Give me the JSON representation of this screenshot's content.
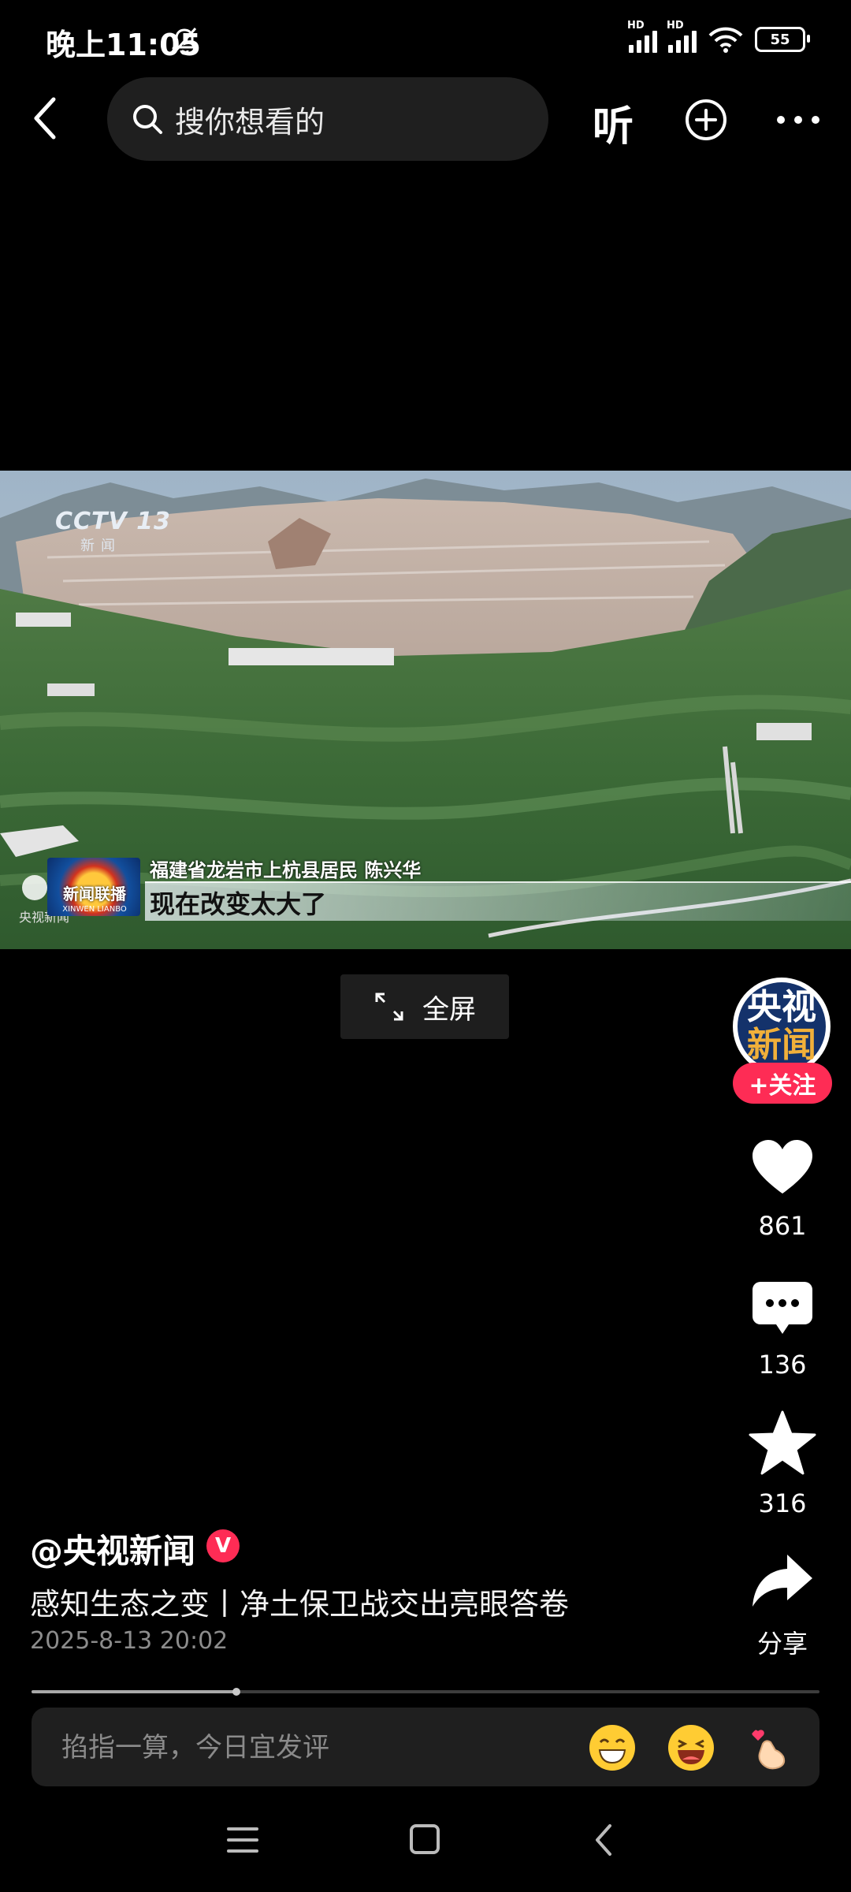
{
  "status_bar": {
    "time": "晚上11:05",
    "battery": "55",
    "network_label": "HD"
  },
  "top_nav": {
    "search_placeholder": "搜你想看的",
    "listen_label": "听"
  },
  "video": {
    "channel_logo": "CCTV 13",
    "channel_sub": "新闻",
    "program_logo_cn": "新闻联播",
    "program_logo_en": "XINWEN LIANBO",
    "corner_watermark": "央视新闻",
    "caption_speaker": "福建省龙岩市上杭县居民 陈兴华",
    "caption_main": "现在改变太大了",
    "fullscreen_label": "全屏"
  },
  "right_rail": {
    "avatar_line1": "央视",
    "avatar_line2": "新闻",
    "follow_label": "+关注",
    "like_count": "861",
    "comment_count": "136",
    "favorite_count": "316",
    "share_label": "分享"
  },
  "post": {
    "author": "@央视新闻",
    "verified_badge": "V",
    "title": "感知生态之变丨净土保卫战交出亮眼答卷",
    "date": "2025-8-13 20:02",
    "progress": 0.26
  },
  "comment_bar": {
    "placeholder": "掐指一算，今日宜发评"
  },
  "colors": {
    "accent": "#fe2c55",
    "background": "#000000",
    "surface": "#1f1f1f"
  }
}
